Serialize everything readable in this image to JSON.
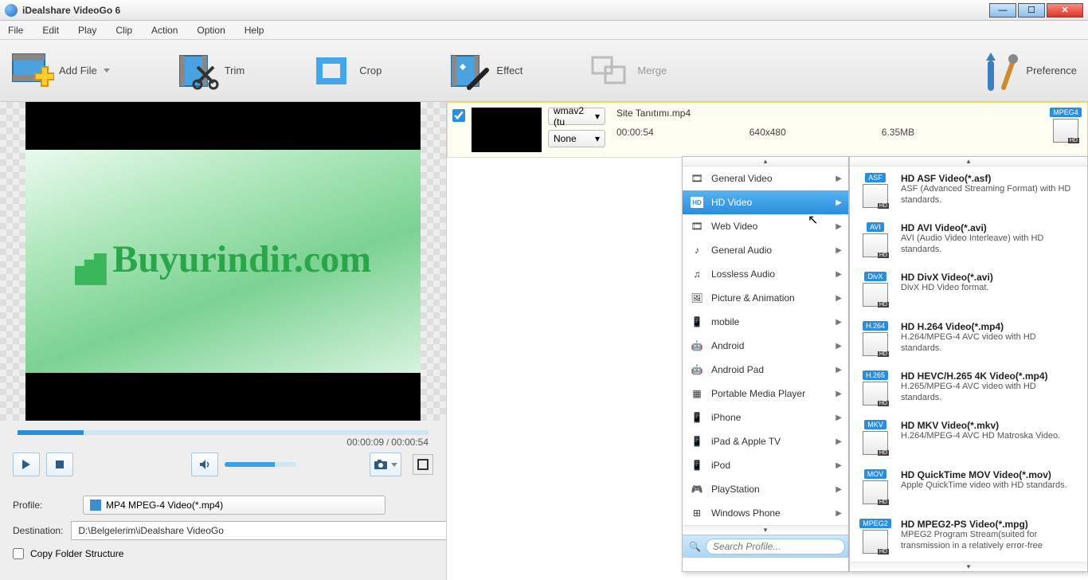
{
  "window": {
    "title": "iDealshare VideoGo 6"
  },
  "menu": [
    "File",
    "Edit",
    "Play",
    "Clip",
    "Action",
    "Option",
    "Help"
  ],
  "toolbar": {
    "add": "Add File",
    "trim": "Trim",
    "crop": "Crop",
    "effect": "Effect",
    "merge": "Merge",
    "pref": "Preference"
  },
  "preview": {
    "brand_main": "Buyur",
    "brand_sub": "indir.com",
    "time_current": "00:00:09",
    "time_total": "00:00:54"
  },
  "profile": {
    "label": "Profile:",
    "value": "MP4 MPEG-4 Video(*.mp4)"
  },
  "destination": {
    "label": "Destination:",
    "value": "D:\\Belgelerim\\iDealshare VideoGo"
  },
  "copy_folder": "Copy Folder Structure",
  "file": {
    "name": "Site Tanıtımı.mp4",
    "codec": "wmav2 (tu",
    "subtitle": "None",
    "duration": "00:00:54",
    "resolution": "640x480",
    "size": "6.35MB",
    "out_format": "MPEG4"
  },
  "categories": [
    "General Video",
    "HD Video",
    "Web Video",
    "General Audio",
    "Lossless Audio",
    "Picture & Animation",
    "mobile",
    "Android",
    "Android Pad",
    "Portable Media Player",
    "iPhone",
    "iPad & Apple TV",
    "iPod",
    "PlayStation",
    "Windows Phone"
  ],
  "category_icons": [
    "🎞",
    "HD",
    "🎞",
    "♪",
    "♫",
    "🖼",
    "📱",
    "🤖",
    "🤖",
    "▦",
    "📱",
    "📱",
    "📱",
    "🎮",
    "⊞"
  ],
  "search_placeholder": "Search Profile...",
  "formats": [
    {
      "badge": "ASF",
      "title": "HD ASF Video(*.asf)",
      "desc": "ASF (Advanced Streaming Format) with HD standards."
    },
    {
      "badge": "AVI",
      "title": "HD AVI Video(*.avi)",
      "desc": "AVI (Audio Video Interleave) with HD standards."
    },
    {
      "badge": "DivX",
      "title": "HD DivX Video(*.avi)",
      "desc": "DivX HD Video format."
    },
    {
      "badge": "H.264",
      "title": "HD H.264 Video(*.mp4)",
      "desc": "H.264/MPEG-4 AVC video with HD standards."
    },
    {
      "badge": "H.265",
      "title": "HD HEVC/H.265 4K Video(*.mp4)",
      "desc": "H.265/MPEG-4 AVC video with HD standards."
    },
    {
      "badge": "MKV",
      "title": "HD MKV Video(*.mkv)",
      "desc": "H.264/MPEG-4 AVC HD Matroska Video."
    },
    {
      "badge": "MOV",
      "title": "HD QuickTime MOV Video(*.mov)",
      "desc": "Apple QuickTime video with HD standards."
    },
    {
      "badge": "MPEG2",
      "title": "HD MPEG2-PS Video(*.mpg)",
      "desc": "MPEG2 Program Stream(suited for transmission in a relatively error-free"
    }
  ]
}
